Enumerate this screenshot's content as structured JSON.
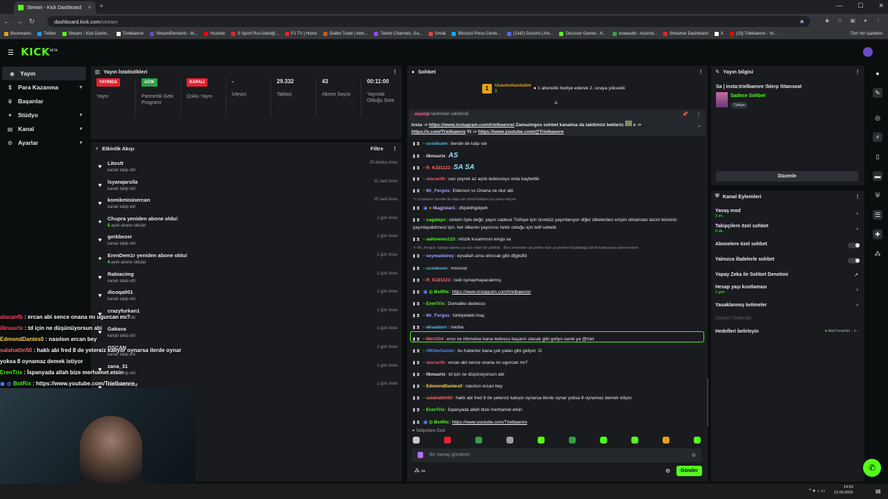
{
  "browser": {
    "tab_title": "Stream - Kick Dashboard",
    "url_host": "dashboard.kick.com",
    "url_path": "/stream",
    "bookmarks": [
      "Bookmarks",
      "Twitter",
      "Stream - Kick Dashb...",
      "Trielbaenre",
      "StreamElements - M...",
      "Youtube",
      "S Sport Plus-İstediği...",
      "F1 TV | Home",
      "Diablo Trade | Item...",
      "Twitch Channels, Ga...",
      "Gmail",
      "Blizzard Press Cente...",
      "(1342) Discord | Ark...",
      "Discover Games - K...",
      "wowaudit - Ascend...",
      "Streamer Dashboard",
      "X",
      "(23) Trielbaenre - Yo..."
    ],
    "all_bookmarks": "Tüm Yer İşaretleri"
  },
  "nav": {
    "items": [
      {
        "label": "Yayın"
      },
      {
        "label": "Para Kazanma"
      },
      {
        "label": "Başarılar"
      },
      {
        "label": "Stüdyo"
      },
      {
        "label": "Kanal"
      },
      {
        "label": "Ayarlar"
      }
    ]
  },
  "stats": {
    "title": "Yayın İstatistikleri",
    "cards": [
      {
        "badge": "YAYINDA",
        "label": "Yayın",
        "color": "#e8212e"
      },
      {
        "badge": "ACIK",
        "label": "Partnerlik Gelir Programı",
        "color": "#2ea043"
      },
      {
        "badge": "KAPALI",
        "label": "Çoklu Yayın",
        "color": "#e8212e"
      }
    ],
    "metrics": [
      {
        "value": "-",
        "label": "İzleyici"
      },
      {
        "value": "29.332",
        "label": "Takipçi"
      },
      {
        "value": "43",
        "label": "Abone Sayısı"
      },
      {
        "value": "00:11:00",
        "label": "Yayında Olduğu Süre"
      }
    ]
  },
  "activity": {
    "title": "Etkinlik Akışı",
    "filter": "Filtre",
    "items": [
      {
        "name": "Litostt",
        "sub": "kanalı takip etti",
        "time": "25 dakika önce",
        "icon": "heart"
      },
      {
        "name": "lsyanqarsila",
        "sub": "kanalı takip etti",
        "time": "11 saat önce",
        "icon": "heart"
      },
      {
        "name": "komikmisinercan",
        "sub": "kanalı takip etti",
        "time": "20 saat önce",
        "icon": "heart"
      },
      {
        "name": "Chupra yeniden abone oldu!",
        "sub_hl": "5",
        "sub": " aylık abone oldular",
        "time": "1 gün önce",
        "icon": "star"
      },
      {
        "name": "gerkbezer",
        "sub": "kanalı takip etti",
        "time": "1 gün önce",
        "icon": "heart"
      },
      {
        "name": "ErenDem1r yeniden abone oldu!",
        "sub_hl": "4",
        "sub": " aylık abone oldular",
        "time": "1 gün önce",
        "icon": "star"
      },
      {
        "name": "Rabiacimg",
        "sub": "kanalı takip etti",
        "time": "1 gün önce",
        "icon": "heart"
      },
      {
        "name": "dicoqa001",
        "sub": "kanalı takip etti",
        "time": "1 gün önce",
        "icon": "heart"
      },
      {
        "name": "crazyfurkan1",
        "sub": "kanalı takip etti",
        "time": "1 gün önce",
        "icon": "heart"
      },
      {
        "name": "Gakava",
        "sub": "kanalı takip etti",
        "time": "1 gün önce",
        "icon": "heart"
      },
      {
        "name": "OSCAN",
        "sub": "kanalı takip etti",
        "time": "1 gün önce",
        "icon": "heart"
      },
      {
        "name": "zana_31",
        "sub": "kanalı takip etti",
        "time": "1 gün önce",
        "icon": "heart"
      },
      {
        "name": "HarunGuclu",
        "sub": "kanalı takip etti",
        "time": "1 gün önce",
        "icon": "heart"
      }
    ]
  },
  "overlay": [
    {
      "u": "atacanfb",
      "t": " : ercan abi sence onana mı ugurcan mı?",
      "c": "#ff4d6d"
    },
    {
      "u": "ilknuurix",
      "t": " : td için ne düşünüyorsun abi",
      "c": "#ff4d6d"
    },
    {
      "u": "EdmondDantes0",
      "t": " : nasılsın ercan bey",
      "c": "#ffd84d"
    },
    {
      "u": "salahattin50",
      "t": " : haklı abi fred 8 de yetersiz kalıyor oynarsa ilerde oynar",
      "t2": "yoksa 8 oynamaz demek istiyor",
      "c": "#ff6b6b"
    },
    {
      "u": "ErenTrix",
      "t": " : İspanyada allah bize merhamet etsin",
      "c": "#53fc18"
    },
    {
      "u": "BotRix",
      "t": " : https://www.youtube.com/Trielbaenre",
      "c": "#53fc18"
    }
  ],
  "chat": {
    "title": "Sohbet",
    "top_user": "Ucanhollandalim",
    "top_count": "3",
    "top_msg": "1 abonelik hediye ederek 2. sıraya yükseldi",
    "pinned_by": "asyazgi",
    "pinned_by_label": " tarafından sabitlendi",
    "pinned_l1a": "Insta -> ",
    "pinned_l1link": "https://www.instagram.com/trielbaenre/",
    "pinned_l1b": " Zamazingos sohbet kanalına da takibinizi bekleriz ",
    "pinned_l1c": " x ->",
    "pinned_l2link1": "https://x.com/Trielbaenre",
    "pinned_l2mid": " Yt -> ",
    "pinned_l2link2": "https://www.youtube.com/@Trielbaenre",
    "messages": [
      {
        "u": "ccoskunn",
        "c": "#5bc0eb",
        "t": "bende de kalp var"
      },
      {
        "u": "ilknuurix",
        "c": "#e7e9ea",
        "t": "",
        "emote": "AS"
      },
      {
        "u": "R_K321123",
        "c": "#ff6b6b",
        "t": "",
        "emote": "SA SA"
      },
      {
        "u": "atacanfb",
        "c": "#ff4d6d",
        "t": "son çeyrek az açtık tedescoyu orda kaybettik"
      },
      {
        "u": "Mr_Fergus",
        "c": "#9aa6ff",
        "t": "Ederson vs Onana ne olur abi"
      },
      {
        "reply": "ccoskunn: bende de kalp var isimli kullanıcıya yanıt veriyor"
      },
      {
        "u": "Magjistar1",
        "c": "#c7a6ff",
        "t": "dfqwklhgdqwh"
      },
      {
        "u": "cagatayc",
        "c": "#53fc18",
        "t": "sistem öyle değil, yayın sadece Türkiye için ücretsiz yayınlanıyor diğer ülkelerden erişim olmaması lazım birisinin"
      },
      {
        "cont": "yayınlayabilmesi için. her ülkenin yayıncısı farklı olduğu için telif sebebi"
      },
      {
        "u": "sahinemu123",
        "c": "#53fc18",
        "t": "müzik kısarmısın kingo sa"
      },
      {
        "reply": "Mr_Fergus: kafaya takma ya olur elbet bir şekilde . Ben erkenden at çektim öyle şeylerden faşfaktağa isimli kullanıcıya yanıt veriyor"
      },
      {
        "u": "seymadeirey",
        "c": "#9aa6ff",
        "t": "eyvallah ama olmıcak gibi dfjgkdfd"
      },
      {
        "u": "ccoskunn",
        "c": "#5bc0eb",
        "t": "msnsnd"
      },
      {
        "u": "R_K321123",
        "c": "#ff6b6b",
        "t": "cedi oynaymayacakmış"
      },
      {
        "u": "BotRix",
        "c": "#53fc18",
        "link": "https://www.instagram.com/trielbaenre/"
      },
      {
        "u": "ErenTrix",
        "c": "#53fc18",
        "t": "Domaliko dedesco"
      },
      {
        "u": "Mr_Fergus",
        "c": "#9aa6ff",
        "t": "türkiyedeki maç"
      },
      {
        "u": "ekvadorrr",
        "c": "#5bc0eb",
        "t": "merba"
      },
      {
        "u": "Mert334",
        "c": "#ff6b6b",
        "t": "erco ne hikmetse bana tedesco başarılı olacak gibi geliyo sanki ya @triel"
      },
      {
        "u": "OKtheGamer",
        "c": "#5b8bff",
        "t": "bu haberler bana çok yalan gibi geliyor :D"
      },
      {
        "u": "atacanfb",
        "c": "#ff4d6d",
        "t": "ercan abi sence onana mı ugurcan mı?"
      },
      {
        "u": "ilknuurix",
        "c": "#e7e9ea",
        "t": "td için ne düşünüyorsun abi"
      },
      {
        "u": "EdmondDantes0",
        "c": "#ffd84d",
        "t": "nasılsın ercan bey"
      },
      {
        "u": "salahattin50",
        "c": "#ff6b6b",
        "t": "haklı abi fred 8 de yetersiz kalıyor oynarsa ilerde oynar yoksa 8 oynamaz demek istiyor"
      },
      {
        "u": "ErenTrix",
        "c": "#53fc18",
        "t": "İspanyada allah bize merhamet etsin"
      },
      {
        "u": "BotRix",
        "c": "#53fc18",
        "link": "https://www.youtube.com/Trielbaenre"
      }
    ],
    "followers_only": "Takipçilere Özel",
    "input_placeholder": "Bir mesaj gönderin",
    "send": "Gönder"
  },
  "stream_info": {
    "title": "Yayın bilgisi",
    "stream_title": "Sa | insta:trielbaenre !blerp !titanseat",
    "category": "Sadece Sohbet",
    "tag": "Türkçe",
    "edit": "Düzenle"
  },
  "channel_actions": {
    "title": "Kanal Eylemleri",
    "slow_mode": "Yavaş mod",
    "slow_mode_val": "3 sn.",
    "followers_chat": "Takipçilere özel sohbet",
    "followers_chat_val": "6 dk.",
    "subs_chat": "Abonelere özel sohbet",
    "emotes_chat": "Yalnızca ifadelerle sohbet",
    "ai_mod": "Yapay Zeka ile Sohbet Denetimi",
    "account_age": "Hesap yaşı kısıtlaması",
    "account_age_val": "2 gün",
    "banned_words": "Yasaklanmış kelimeler",
    "viewer_redirect": "İzleyici Yönlendir",
    "goals": "Hedefleri belirleyin",
    "goals_val": "Aktif hedefler - 2"
  },
  "taskbar": {
    "time": "14:03",
    "date": "12.09.2025"
  }
}
